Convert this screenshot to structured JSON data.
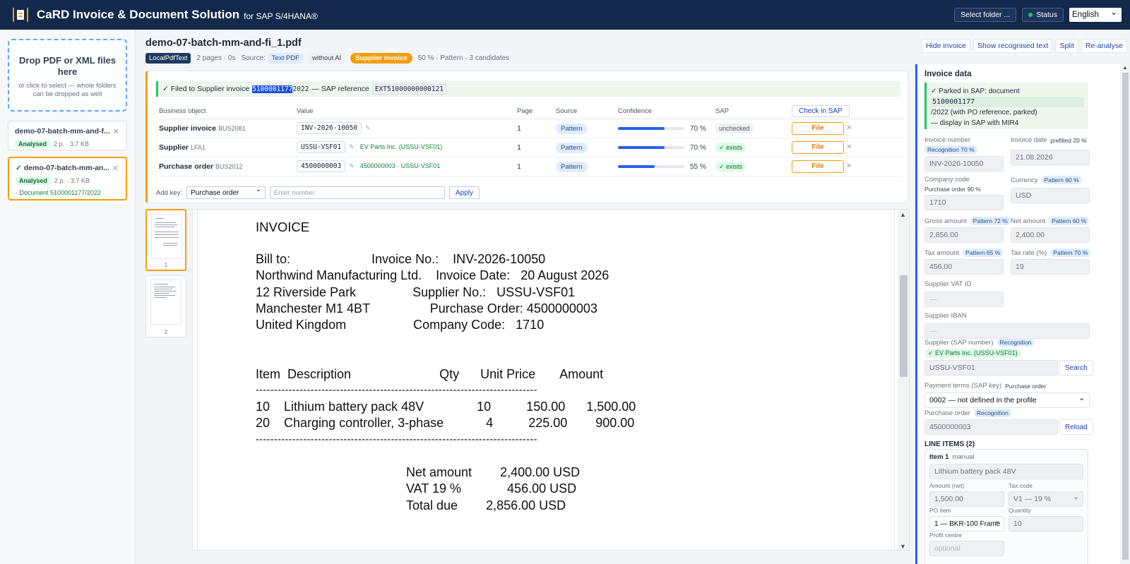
{
  "header": {
    "title": "CaRD Invoice & Document Solution",
    "subtitle": "for SAP S/4HANA®",
    "select_folder": "Select folder ...",
    "status": "Status",
    "language": "English"
  },
  "sidebar": {
    "drop_title": "Drop PDF or XML files here",
    "drop_hint": "or click to select — whole folders can be dropped as well",
    "files": [
      {
        "name": "demo-07-batch-mm-and-fi_1.pdf",
        "display": "demo-07-batch-mm-and-f...",
        "status": "Analysed",
        "meta": "2 p. · 3.7 KB"
      },
      {
        "check": "✓",
        "display": "demo-07-batch-mm-an...",
        "status": "Analysed",
        "meta": "2 p. · 3.7 KB",
        "doc": "· Document 5100001177/2022"
      }
    ]
  },
  "document": {
    "filename": "demo-07-batch-mm-and-fi_1.pdf",
    "engine": "LocalPdfText",
    "pages_time": "2 pages · 0s",
    "source_label": "Source:",
    "source": "Text PDF",
    "ai": "without AI",
    "doc_type": "Supplier invoice",
    "score": "50 % · Pattern · 3 candidates"
  },
  "actions": {
    "hide_invoice": "Hide invoice",
    "show_text": "Show recognised text",
    "split": "Split",
    "reanalyse": "Re-analyse"
  },
  "filed": {
    "prefix": "✓ Filed to Supplier invoice",
    "doc_sel": "5100001177",
    "doc_rest": "2022",
    "mid": "— SAP reference",
    "ref": "EXT51000000000121"
  },
  "bo_table": {
    "headers": {
      "object": "Business object",
      "value": "Value",
      "page": "Page",
      "source": "Source",
      "confidence": "Confidence",
      "sap": "SAP",
      "check": "Check in SAP"
    },
    "rows": [
      {
        "name": "Supplier invoice",
        "code": "BUS2081",
        "value": "INV-2026-10050",
        "link": "",
        "page": "1",
        "source": "Pattern",
        "conf": 70,
        "conf_label": "70 %",
        "sap": "unchecked",
        "file": "File"
      },
      {
        "name": "Supplier",
        "code": "LFA1",
        "value": "USSU-VSF01",
        "link": "EV Parts Inc. (USSU-VSF01)",
        "page": "1",
        "source": "Pattern",
        "conf": 70,
        "conf_label": "70 %",
        "sap": "✓ exists",
        "file": "File"
      },
      {
        "name": "Purchase order",
        "code": "BUS2012",
        "value": "4500000003",
        "link": "4500000003 · USSU-VSF01",
        "page": "1",
        "source": "Pattern",
        "conf": 55,
        "conf_label": "55 %",
        "sap": "✓ exists",
        "file": "File"
      }
    ]
  },
  "add_key": {
    "label": "Add key:",
    "selected": "Purchase order",
    "placeholder": "Enter number",
    "apply": "Apply"
  },
  "thumbs": [
    "1",
    "2"
  ],
  "invoice_text": {
    "title": "INVOICE",
    "lines": [
      "Bill to:                       Invoice No.:    INV-2026-10050",
      "Northwind Manufacturing Ltd.    Invoice Date:   20 August 2026",
      "12 Riverside Park                Supplier No.:   USSU-VSF01",
      "Manchester M1 4BT                 Purchase Order: 4500000003",
      "United Kingdom                   Company Code:   1710"
    ],
    "table_header": "Item  Description                         Qty      Unit Price       Amount",
    "dash": "-----------------------------------------------------------------------------",
    "items": [
      "10    Lithium battery pack 48V               10          150.00      1,500.00",
      "20    Charging controller, 3-phase            4          225.00        900.00"
    ],
    "totals": [
      "Net amount        2,400.00 USD",
      "VAT 19 %             456.00 USD",
      "Total due        2,856.00 USD"
    ]
  },
  "invoice_data": {
    "heading": "Invoice data",
    "parked": {
      "line1": "✓ Parked in SAP: document",
      "num": "5100001177",
      "line3": "/2022 (with PO reference, parked)",
      "line4": "— display in SAP with MIR4"
    },
    "invoice_number": {
      "label": "Invoice number",
      "pill": "Recognition 70 %",
      "value": "INV-2026-10050"
    },
    "invoice_date": {
      "label": "Invoice date",
      "note": "prefilled 20 %",
      "value": "21.08.2026"
    },
    "company_code": {
      "label": "Company code",
      "note": "Purchase order 90 %",
      "value": "1710"
    },
    "currency": {
      "label": "Currency",
      "pill": "Pattern 60 %",
      "value": "USD"
    },
    "gross": {
      "label": "Gross amount",
      "pill": "Pattern 72 %",
      "value": "2,856.00"
    },
    "net": {
      "label": "Net amount",
      "pill": "Pattern 60 %",
      "value": "2,400.00"
    },
    "tax": {
      "label": "Tax amount",
      "pill": "Pattern 65 %",
      "value": "456.00"
    },
    "tax_rate": {
      "label": "Tax rate (%)",
      "pill": "Pattern 70 %",
      "value": "19"
    },
    "vat_id": {
      "label": "Supplier VAT ID",
      "value": "—"
    },
    "iban": {
      "label": "Supplier IBAN",
      "value": "—"
    },
    "supplier": {
      "label": "Supplier (SAP number)",
      "pill": "Recognition",
      "match": "✓ EV Parts Inc. (USSU-VSF01)",
      "value": "USSU-VSF01",
      "button": "Search"
    },
    "payment_terms": {
      "label": "Payment terms (SAP key)",
      "note": "Purchase order",
      "value": "0002 — not defined in the profile"
    },
    "purchase_order": {
      "label": "Purchase order",
      "pill": "Recognition",
      "value": "4500000003",
      "button": "Reload"
    },
    "line_items_title": "LINE ITEMS (2)",
    "item": {
      "title": "Item 1",
      "mode": "manual",
      "description": "Lithium battery pack 48V",
      "amount_label": "Amount (net)",
      "amount": "1,500.00",
      "taxcode_label": "Tax code",
      "taxcode": "V1 — 19 %",
      "po_item_label": "PO item",
      "po_item": "1 — BKR-100 Frame",
      "qty_label": "Quantity",
      "qty": "10",
      "profit_label": "Profit centre",
      "profit_placeholder": "optional"
    }
  },
  "colors": {
    "header_bg": "#13294b",
    "accent": "#f59e0b",
    "link": "#1e40af",
    "success": "#15803d"
  }
}
